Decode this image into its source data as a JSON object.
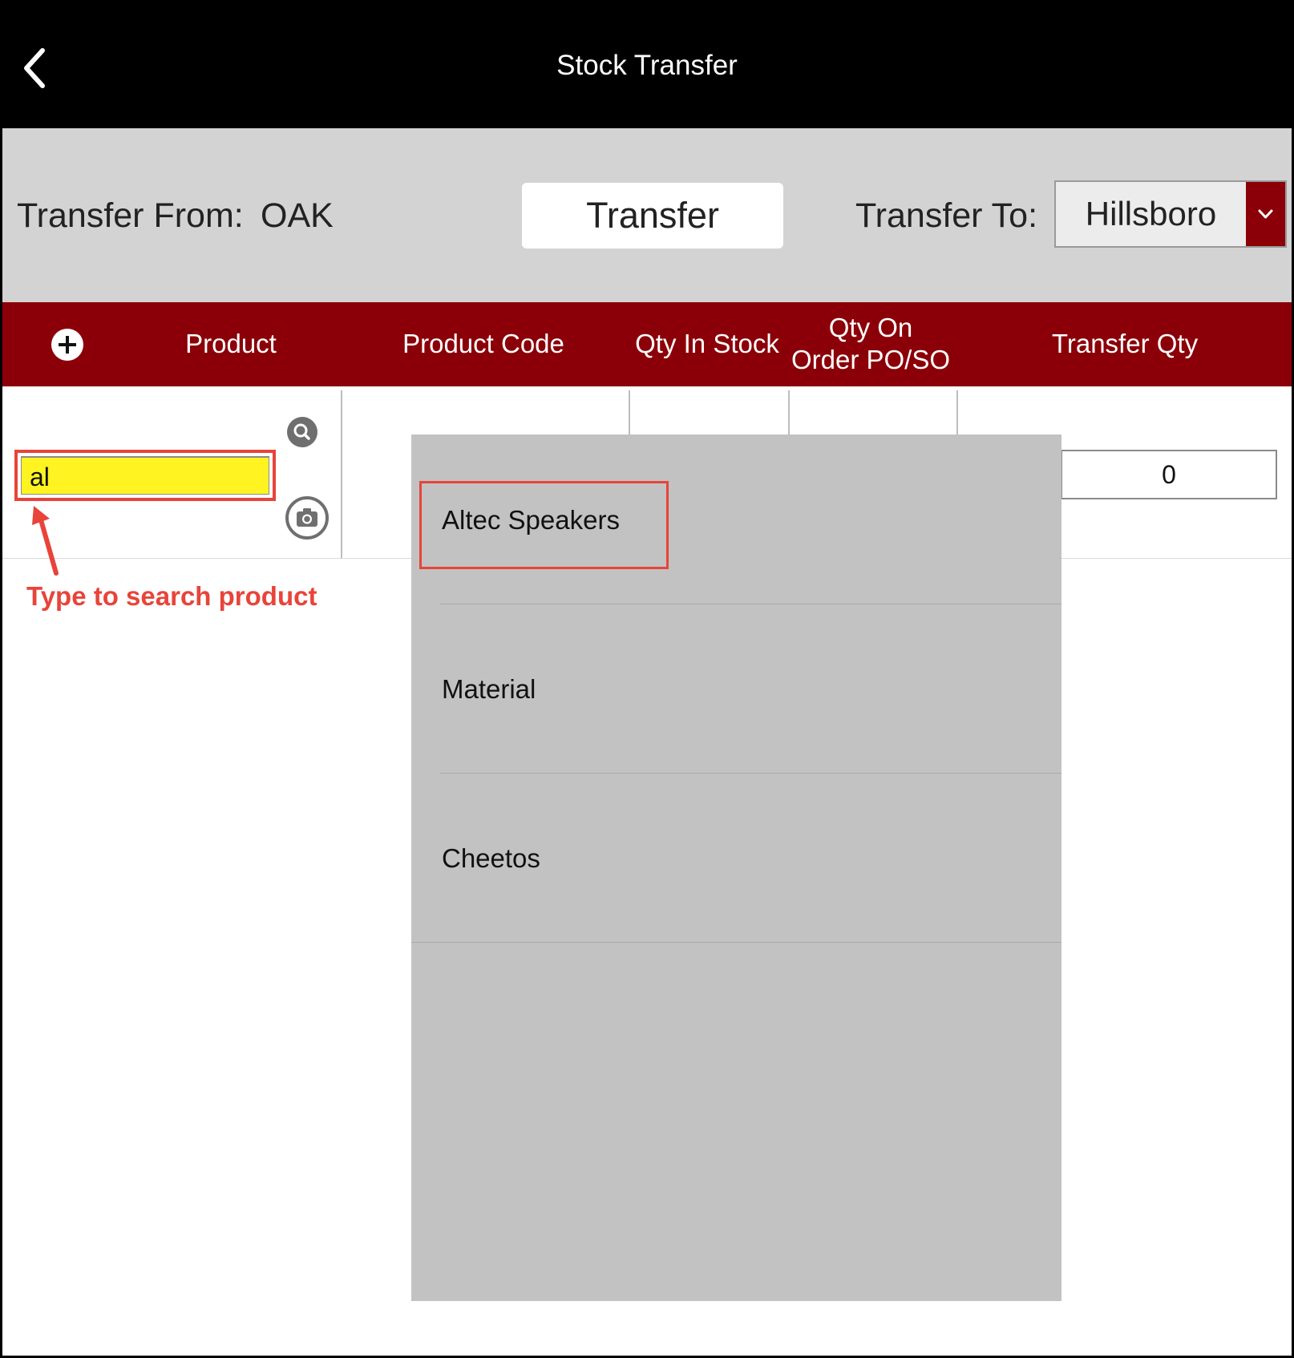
{
  "nav": {
    "title": "Stock Transfer"
  },
  "transfer_bar": {
    "from_label": "Transfer From:",
    "from_value": "OAK",
    "transfer_button": "Transfer",
    "to_label": "Transfer To:",
    "to_value": "Hillsboro"
  },
  "table": {
    "columns": [
      "Product",
      "Product Code",
      "Qty In Stock",
      "Qty On\nOrder PO/SO",
      "Transfer Qty"
    ],
    "row": {
      "product_value": "al",
      "transfer_qty": "0"
    }
  },
  "dropdown": {
    "items": [
      "Altec Speakers",
      "Material",
      "Cheetos"
    ]
  },
  "annotation": {
    "text": "Type to search product"
  },
  "colors": {
    "header_red": "#8b0008",
    "highlight_yellow": "#fff421",
    "annotation_red": "#e8443a"
  },
  "icons": {
    "back": "chevron-left-icon",
    "add": "plus-circle-icon",
    "search": "search-icon",
    "camera": "camera-icon",
    "dropdown": "chevron-down-icon"
  }
}
